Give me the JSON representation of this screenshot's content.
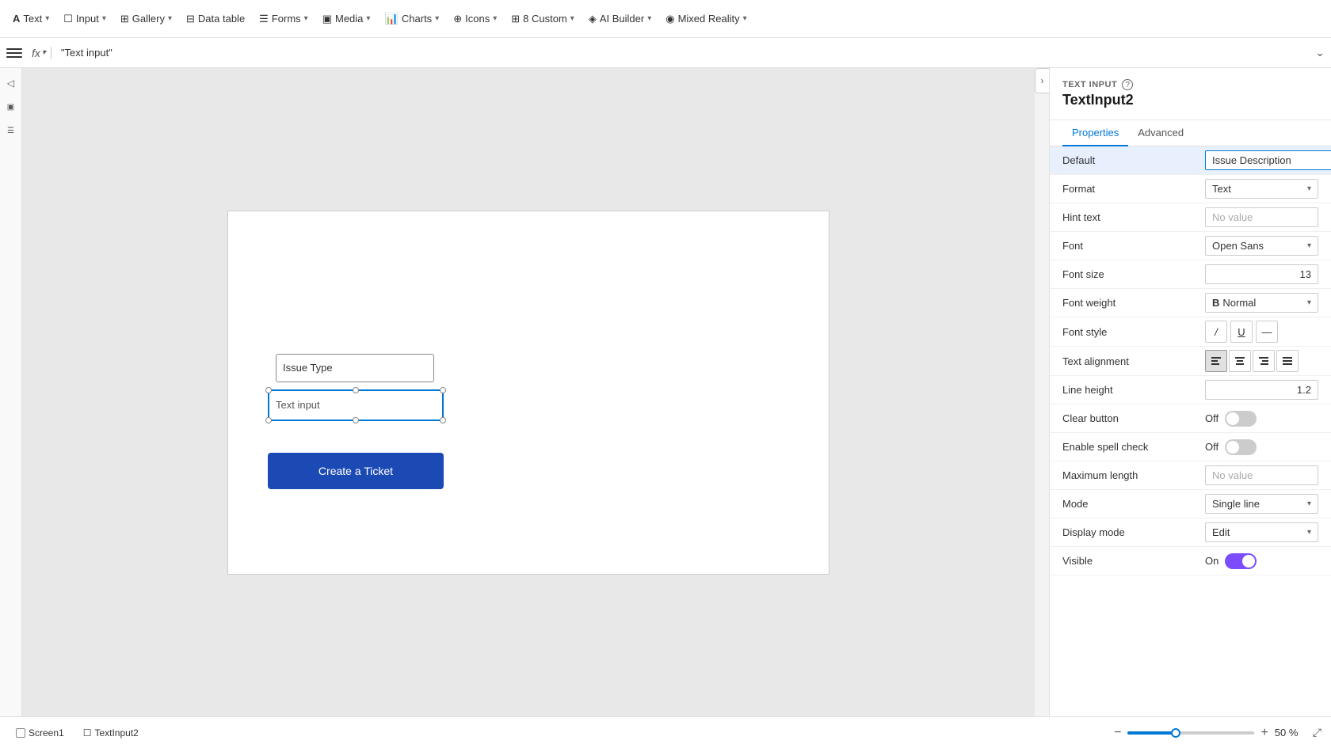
{
  "toolbar": {
    "items": [
      {
        "id": "text",
        "icon": "T",
        "label": "Text",
        "hasChevron": true
      },
      {
        "id": "input",
        "icon": "☐",
        "label": "Input",
        "hasChevron": true
      },
      {
        "id": "gallery",
        "icon": "⊞",
        "label": "Gallery",
        "hasChevron": true
      },
      {
        "id": "datatable",
        "icon": "⊟",
        "label": "Data table",
        "hasChevron": false
      },
      {
        "id": "forms",
        "icon": "☰",
        "label": "Forms",
        "hasChevron": true
      },
      {
        "id": "media",
        "icon": "▣",
        "label": "Media",
        "hasChevron": true
      },
      {
        "id": "charts",
        "icon": "📊",
        "label": "Charts",
        "hasChevron": true
      },
      {
        "id": "icons",
        "icon": "⊕",
        "label": "Icons",
        "hasChevron": true
      },
      {
        "id": "custom",
        "icon": "⊞",
        "label": "8 Custom",
        "hasChevron": true
      },
      {
        "id": "ai-builder",
        "icon": "◈",
        "label": "AI Builder",
        "hasChevron": true
      },
      {
        "id": "mixed-reality",
        "icon": "◉",
        "label": "Mixed Reality",
        "hasChevron": true
      }
    ]
  },
  "formula_bar": {
    "fx_label": "fx",
    "value": "\"Text input\"",
    "expand_icon": "⌄"
  },
  "canvas": {
    "issue_type_placeholder": "Issue Type",
    "text_input_placeholder": "Text input",
    "button_label": "Create a Ticket"
  },
  "right_panel": {
    "section_label": "TEXT INPUT",
    "component_name": "TextInput2",
    "tabs": [
      {
        "id": "properties",
        "label": "Properties",
        "active": true
      },
      {
        "id": "advanced",
        "label": "Advanced",
        "active": false
      }
    ],
    "properties": {
      "default_label": "Default",
      "default_value": "Issue Description",
      "format_label": "Format",
      "format_value": "Text",
      "hint_text_label": "Hint text",
      "hint_text_placeholder": "No value",
      "font_label": "Font",
      "font_value": "Open Sans",
      "font_size_label": "Font size",
      "font_size_value": "13",
      "font_weight_label": "Font weight",
      "font_weight_value": "Normal",
      "font_style_label": "Font style",
      "font_style_italic": "/",
      "font_style_underline": "U",
      "font_style_strikethrough": "—",
      "text_alignment_label": "Text alignment",
      "line_height_label": "Line height",
      "line_height_value": "1.2",
      "clear_button_label": "Clear button",
      "clear_button_state": "Off",
      "spell_check_label": "Enable spell check",
      "spell_check_state": "Off",
      "max_length_label": "Maximum length",
      "max_length_placeholder": "No value",
      "mode_label": "Mode",
      "mode_value": "Single line",
      "display_mode_label": "Display mode",
      "display_mode_value": "Edit",
      "visible_label": "Visible",
      "visible_state": "On"
    }
  },
  "bottom_bar": {
    "screen1_label": "Screen1",
    "textinput2_label": "TextInput2",
    "zoom_minus": "−",
    "zoom_plus": "+",
    "zoom_value": "50 %"
  }
}
